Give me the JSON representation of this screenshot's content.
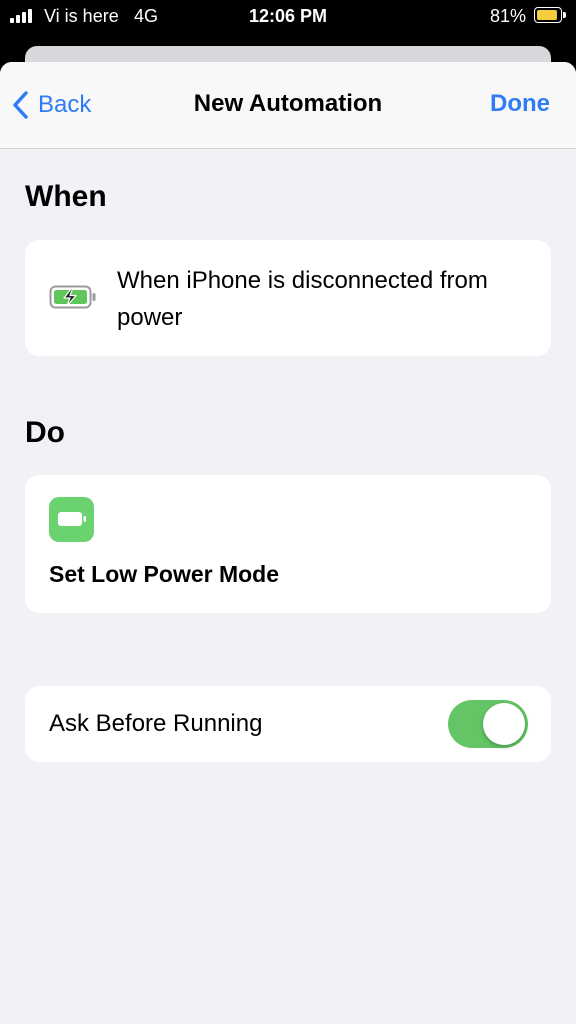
{
  "status_bar": {
    "carrier": "Vi is here",
    "network": "4G",
    "time": "12:06 PM",
    "battery_percent": "81%",
    "battery_level": 0.81,
    "battery_color": "#f3cf3f"
  },
  "nav": {
    "back_label": "Back",
    "title": "New Automation",
    "done_label": "Done",
    "accent_color": "#2f7cf6"
  },
  "when": {
    "header": "When",
    "trigger_icon": "battery-charging-icon",
    "trigger_text": "When iPhone is disconnected from power"
  },
  "do": {
    "header": "Do",
    "action_icon": "battery-icon",
    "action_label": "Set Low Power Mode",
    "action_icon_color": "#6ad26e"
  },
  "ask_before_running": {
    "label": "Ask Before Running",
    "enabled": true,
    "toggle_color": "#63c565"
  }
}
